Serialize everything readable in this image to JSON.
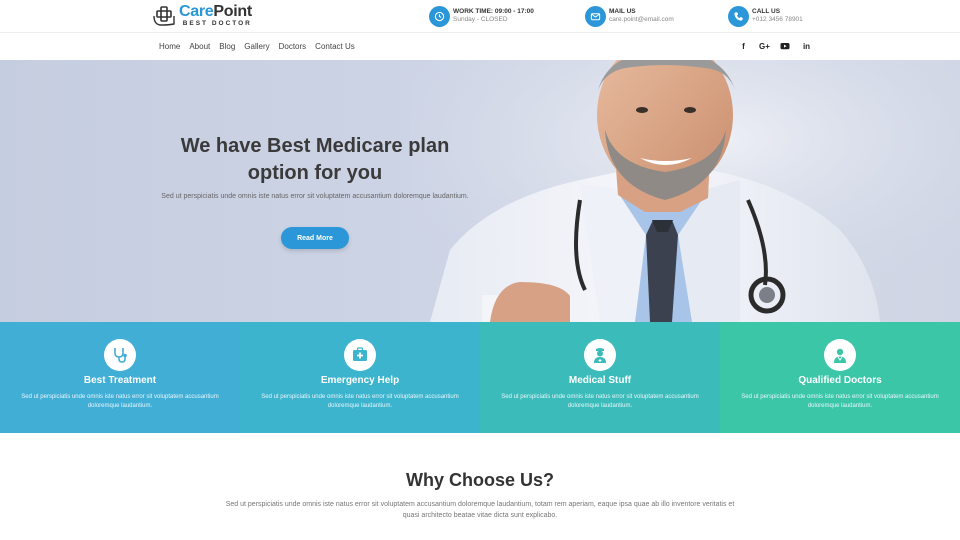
{
  "brand": {
    "name_part1": "Care",
    "name_part2": "Point",
    "tagline": "BEST DOCTOR"
  },
  "contacts": [
    {
      "label": "WORK TIME: 09:00 - 17:00",
      "value": "Sunday - CLOSED",
      "icon": "clock-icon"
    },
    {
      "label": "MAIL US",
      "value": "care.point@email.com",
      "icon": "mail-icon"
    },
    {
      "label": "CALL US",
      "value": "+012 3456 78901",
      "icon": "phone-icon"
    }
  ],
  "nav": [
    "Home",
    "About",
    "Blog",
    "Gallery",
    "Doctors",
    "Contact Us"
  ],
  "social": {
    "facebook": "f",
    "google": "G+",
    "youtube": "youtube-icon",
    "linkedin": "in"
  },
  "hero": {
    "title_line1": "We have Best Medicare plan",
    "title_line2": "option for you",
    "subtitle": "Sed ut perspiciatis unde omnis iste natus error sit voluptatem accusantium doloremque laudantium.",
    "button": "Read More"
  },
  "features": [
    {
      "title": "Best Treatment",
      "text": "Sed ut perspiciatis unde omnis iste natus error sit voluptatem accusantium doloremque laudantium.",
      "icon": "stethoscope-icon",
      "color": "#41aed5"
    },
    {
      "title": "Emergency Help",
      "text": "Sed ut perspiciatis unde omnis iste natus error sit voluptatem accusantium doloremque laudantium.",
      "icon": "medical-kit-icon",
      "color": "#3cb4cd"
    },
    {
      "title": "Medical Stuff",
      "text": "Sed ut perspiciatis unde omnis iste natus error sit voluptatem accusantium doloremque laudantium.",
      "icon": "nurse-icon",
      "color": "#3bbcba"
    },
    {
      "title": "Qualified Doctors",
      "text": "Sed ut perspiciatis unde omnis iste natus error sit voluptatem accusantium doloremque laudantium.",
      "icon": "doctor-icon",
      "color": "#3bc6a8"
    }
  ],
  "why": {
    "title": "Why Choose Us?",
    "text": "Sed ut perspiciatis unde omnis iste natus error sit voluptatem accusantium doloremque laudantium, totam rem aperiam, eaque ipsa quae ab illo inventore veritatis et quasi architecto beatae vitae dicta sunt explicabo."
  },
  "colors": {
    "accent": "#2b96d8",
    "text_dark": "#333333"
  }
}
